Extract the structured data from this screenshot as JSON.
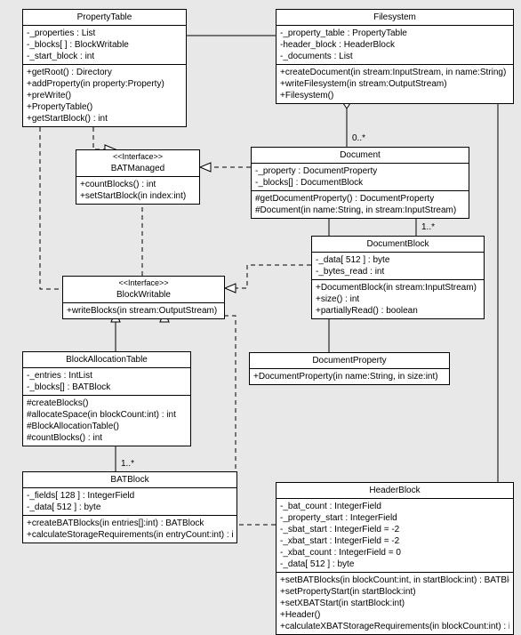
{
  "classes": {
    "PropertyTable": {
      "title": "PropertyTable",
      "attrs": [
        "-_properties : List",
        "-_blocks[ ] : BlockWritable",
        "-_start_block : int"
      ],
      "ops": [
        "+getRoot() : Directory",
        "+addProperty(in property:Property)",
        "+preWrite()",
        "+PropertyTable()",
        "+getStartBlock() : int"
      ]
    },
    "Filesystem": {
      "title": "Filesystem",
      "attrs": [
        "-_property_table : PropertyTable",
        "-header_block : HeaderBlock",
        "-_documents : List"
      ],
      "ops": [
        "+createDocument(in stream:InputStream, in name:String)",
        "+writeFilesystem(in stream:OutputStream)",
        "+Filesystem()"
      ]
    },
    "BATManaged": {
      "stereotype": "<<Interface>>",
      "title": "BATManaged",
      "ops": [
        "+countBlocks() : int",
        "+setStartBlock(in index:int)"
      ]
    },
    "Document": {
      "title": "Document",
      "attrs": [
        "-_property : DocumentProperty",
        "-_blocks[] : DocumentBlock"
      ],
      "ops": [
        "#getDocumentProperty() : DocumentProperty",
        "#Document(in name:String, in stream:InputStream)"
      ]
    },
    "DocumentBlock": {
      "title": "DocumentBlock",
      "attrs": [
        "-_data[ 512 ] : byte",
        "-_bytes_read : int"
      ],
      "ops": [
        "+DocumentBlock(in stream:InputStream)",
        "+size() : int",
        "+partiallyRead() : boolean"
      ]
    },
    "BlockWritable": {
      "stereotype": "<<Interface>>",
      "title": "BlockWritable",
      "ops": [
        "+writeBlocks(in stream:OutputStream)"
      ]
    },
    "DocumentProperty": {
      "title": "DocumentProperty",
      "ops": [
        "+DocumentProperty(in name:String, in size:int)"
      ]
    },
    "BlockAllocationTable": {
      "title": "BlockAllocationTable",
      "attrs": [
        "-_entries : IntList",
        "-_blocks[] : BATBlock"
      ],
      "ops": [
        "#createBlocks()",
        "#allocateSpace(in blockCount:int) : int",
        "#BlockAllocationTable()",
        "#countBlocks() : int"
      ]
    },
    "BATBlock": {
      "title": "BATBlock",
      "attrs": [
        "-_fields[ 128 ] : IntegerField",
        "-_data[ 512 ] : byte"
      ],
      "ops": [
        "+createBATBlocks(in entries[]:int) : BATBlock",
        "+calculateStorageRequirements(in entryCount:int) : int"
      ]
    },
    "HeaderBlock": {
      "title": "HeaderBlock",
      "attrs": [
        "-_bat_count : IntegerField",
        "-_property_start : IntegerField",
        "-_sbat_start : IntegerField = -2",
        "-_xbat_start : IntegerField = -2",
        "-_xbat_count : IntegerField = 0",
        "-_data[ 512 ] : byte"
      ],
      "ops": [
        "+setBATBlocks(in blockCount:int, in startBlock:int) : BATBlock",
        "+setPropertyStart(in startBlock:int)",
        "+setXBATStart(in startBlock:int)",
        "+Header()",
        "+calculateXBATStorageRequirements(in blockCount:int) : int"
      ]
    }
  },
  "multiplicities": {
    "fs_doc": "0..*",
    "doc_block": "1..*",
    "bat_block": "1..*"
  }
}
